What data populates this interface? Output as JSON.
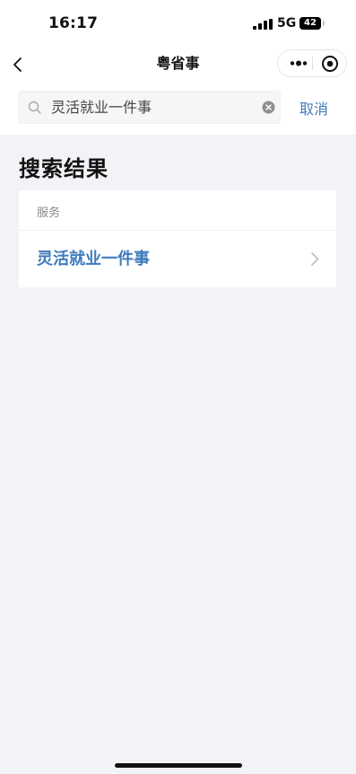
{
  "status_bar": {
    "time": "16:17",
    "network": "5G",
    "battery": "42"
  },
  "nav": {
    "title": "粤省事"
  },
  "search": {
    "query": "灵活就业一件事",
    "cancel_label": "取消"
  },
  "results": {
    "title": "搜索结果",
    "section_label": "服务",
    "items": [
      {
        "label": "灵活就业一件事"
      }
    ]
  },
  "colors": {
    "accent": "#3f7bbd",
    "background": "#f2f3f7"
  }
}
